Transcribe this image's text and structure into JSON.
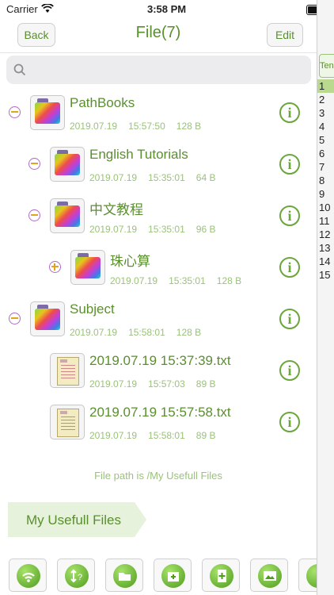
{
  "status": {
    "carrier": "Carrier",
    "time": "3:58 PM"
  },
  "nav": {
    "back_label": "Back",
    "title": "File(7)",
    "edit_label": "Edit"
  },
  "search": {
    "placeholder": ""
  },
  "tree": [
    {
      "name": "PathBooks",
      "date": "2019.07.19",
      "time": "15:57:50",
      "size": "128 B",
      "type": "folder",
      "toggle": "minus"
    },
    {
      "name": "English Tutorials",
      "date": "2019.07.19",
      "time": "15:35:01",
      "size": "64 B",
      "type": "folder",
      "toggle": "minus"
    },
    {
      "name": "中文教程",
      "date": "2019.07.19",
      "time": "15:35:01",
      "size": "96 B",
      "type": "folder",
      "toggle": "minus"
    },
    {
      "name": "珠心算",
      "date": "2019.07.19",
      "time": "15:35:01",
      "size": "128 B",
      "type": "folder",
      "toggle": "plus"
    },
    {
      "name": "Subject",
      "date": "2019.07.19",
      "time": "15:58:01",
      "size": "128 B",
      "type": "folder",
      "toggle": "minus"
    },
    {
      "name": "2019.07.19    15:37:39.txt",
      "date": "2019.07.19",
      "time": "15:57:03",
      "size": "89 B",
      "type": "file",
      "toggle": ""
    },
    {
      "name": "2019.07.19    15:57:58.txt",
      "date": "2019.07.19",
      "time": "15:58:01",
      "size": "89 B",
      "type": "file",
      "toggle": ""
    }
  ],
  "path_text": "File path is /My  Usefull  Files",
  "folder_tag": "My  Usefull  Files",
  "toolbar": [
    "wifi-transfer-icon",
    "sort-help-icon",
    "open-folder-icon",
    "new-folder-icon",
    "new-file-icon",
    "add-image-icon",
    "transfer-icon"
  ],
  "side_panel": {
    "tab_label": "Ten",
    "line_numbers": [
      "1",
      "2",
      "3",
      "4",
      "5",
      "6",
      "7",
      "8",
      "9",
      "10",
      "11",
      "12",
      "13",
      "14",
      "15"
    ],
    "active_line": "1"
  },
  "colors": {
    "accent": "#5a8f2e",
    "meta": "#9bc27a"
  }
}
